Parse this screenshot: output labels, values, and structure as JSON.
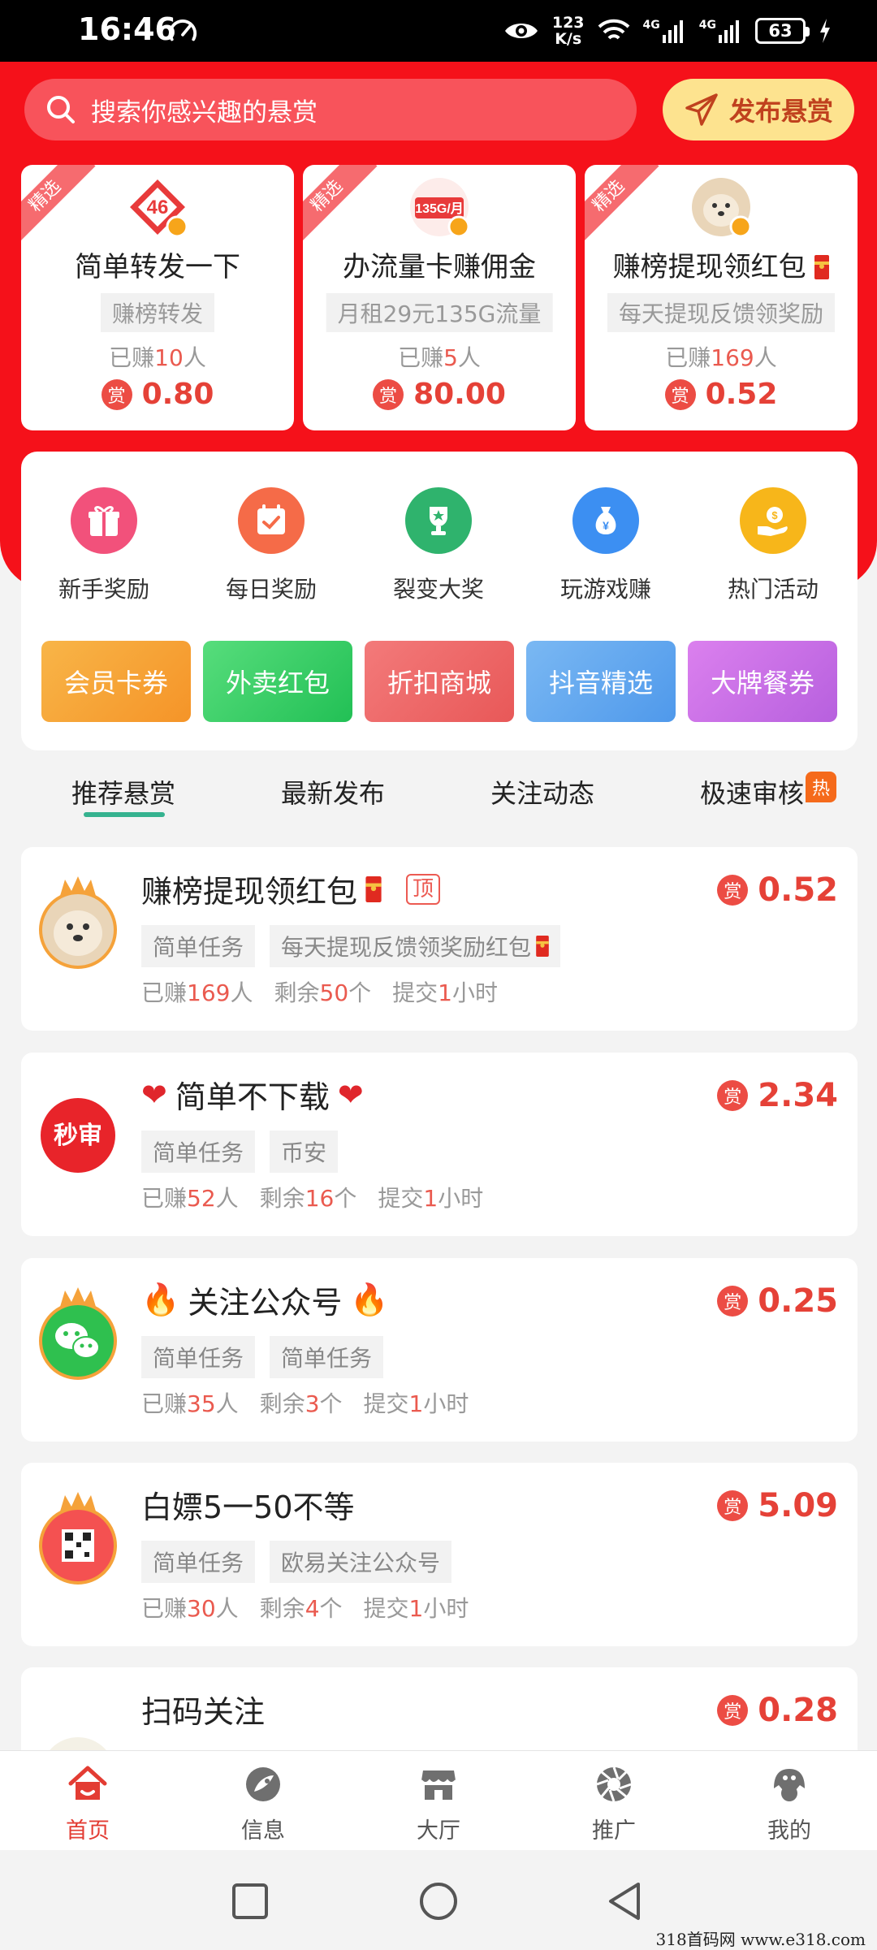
{
  "status_bar": {
    "time": "16:46",
    "net_speed_value": "123",
    "net_speed_unit": "K/s",
    "signal1": "4G",
    "signal2": "4G",
    "battery": "63"
  },
  "search": {
    "placeholder": "搜索你感兴趣的悬赏"
  },
  "publish_button": {
    "label": "发布悬赏"
  },
  "featured": [
    {
      "ribbon": "精选",
      "title": "简单转发一下",
      "tag": "赚榜转发",
      "earned_prefix": "已赚",
      "earned_count": "10",
      "earned_suffix": "人",
      "reward_badge": "赏",
      "amount": "0.80"
    },
    {
      "ribbon": "精选",
      "title": "办流量卡赚佣金",
      "tag": "月租29元135G流量",
      "earned_prefix": "已赚",
      "earned_count": "5",
      "earned_suffix": "人",
      "reward_badge": "赏",
      "amount": "80.00"
    },
    {
      "ribbon": "精选",
      "title": "赚榜提现领红包",
      "tag": "每天提现反馈领奖励",
      "earned_prefix": "已赚",
      "earned_count": "169",
      "earned_suffix": "人",
      "reward_badge": "赏",
      "amount": "0.52"
    }
  ],
  "entries": [
    {
      "label": "新手奖励",
      "icon": "gift-icon",
      "color": "#f2517b"
    },
    {
      "label": "每日奖励",
      "icon": "calendar-check-icon",
      "color": "#f56b48"
    },
    {
      "label": "裂变大奖",
      "icon": "trophy-icon",
      "color": "#2fb36d"
    },
    {
      "label": "玩游戏赚",
      "icon": "money-bag-icon",
      "color": "#3c8ff2"
    },
    {
      "label": "热门活动",
      "icon": "coin-hand-icon",
      "color": "#f7b61a"
    }
  ],
  "promos": [
    {
      "label": "会员卡券",
      "color": "#f7a436"
    },
    {
      "label": "外卖红包",
      "color": "#3ccf6a"
    },
    {
      "label": "折扣商城",
      "color": "#f06868"
    },
    {
      "label": "抖音精选",
      "color": "#5fa7ef"
    },
    {
      "label": "大牌餐券",
      "color": "#c76ee5"
    }
  ],
  "tabs": [
    {
      "label": "推荐悬赏"
    },
    {
      "label": "最新发布"
    },
    {
      "label": "关注动态"
    },
    {
      "label": "极速审核"
    }
  ],
  "hot_badge": "热",
  "tasks": [
    {
      "title": "赚榜提现领红包",
      "top_badge": "顶",
      "tags": [
        "简单任务",
        "每天提现反馈领奖励红包"
      ],
      "earned": "169",
      "remaining": "50",
      "submit": "1",
      "reward_badge": "赏",
      "amount": "0.52"
    },
    {
      "title": "简单不下载",
      "tags": [
        "简单任务",
        "币安"
      ],
      "earned": "52",
      "remaining": "16",
      "submit": "1",
      "reward_badge": "赏",
      "amount": "2.34",
      "avatar_text": "秒审"
    },
    {
      "title": "关注公众号",
      "tags": [
        "简单任务",
        "简单任务"
      ],
      "earned": "35",
      "remaining": "3",
      "submit": "1",
      "reward_badge": "赏",
      "amount": "0.25"
    },
    {
      "title": "白嫖5一50不等",
      "tags": [
        "简单任务",
        "欧易关注公众号"
      ],
      "earned": "30",
      "remaining": "4",
      "submit": "1",
      "reward_badge": "赏",
      "amount": "5.09"
    },
    {
      "title": "扫码关注",
      "reward_badge": "赏",
      "amount": "0.28"
    }
  ],
  "stat_labels": {
    "earned_prefix": "已赚",
    "earned_suffix": "人",
    "remaining_prefix": "剩余",
    "remaining_suffix": "个",
    "submit_prefix": "提交",
    "submit_suffix": "小时"
  },
  "bottom_nav": [
    {
      "label": "首页",
      "icon": "home-icon",
      "active": true
    },
    {
      "label": "信息",
      "icon": "message-icon"
    },
    {
      "label": "大厅",
      "icon": "shop-icon"
    },
    {
      "label": "推广",
      "icon": "aperture-icon"
    },
    {
      "label": "我的",
      "icon": "profile-icon"
    }
  ],
  "watermark": "318首码网  www.e318.com",
  "colors": {
    "brand_red": "#f5111a",
    "reward_red": "#e54137",
    "tab_green": "#35b28f"
  }
}
